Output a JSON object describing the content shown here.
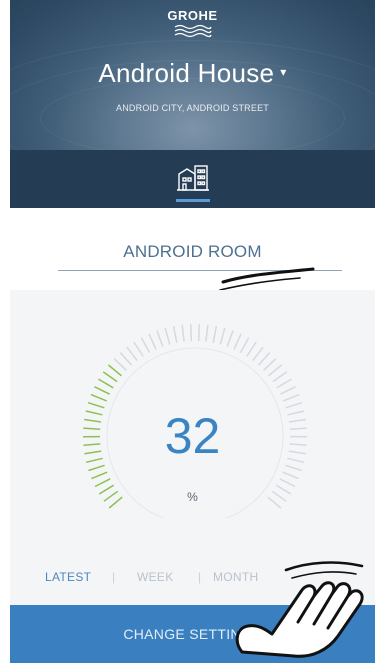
{
  "brand": {
    "logo_text": "GROHE",
    "logo_name": "grohe-logo"
  },
  "home": {
    "title": "Android House",
    "dropdown_caret": "▾",
    "address": "ANDROID CITY, ANDROID STREET"
  },
  "nav": {
    "active_tab_icon": "building-icon"
  },
  "room": {
    "name": "ANDROID ROOM"
  },
  "gauge": {
    "value": "32",
    "unit": "%",
    "level_fraction": 0.32
  },
  "periods": {
    "items": [
      {
        "label": "LATEST",
        "active": true
      },
      {
        "label": "WEEK",
        "active": false
      },
      {
        "label": "MONTH",
        "active": false
      }
    ],
    "separator": "|"
  },
  "action": {
    "label": "CHANGE SETTINGS"
  },
  "overlay": {
    "gesture_icon": "tap-hand-icon",
    "swipe_icon": "swipe-gesture-icon"
  },
  "colors": {
    "header": "#2e4a64",
    "accent": "#3a84c4",
    "button": "#3a7fc0",
    "gauge_active": "#8cc152",
    "gauge_inactive": "#d4dae0"
  }
}
